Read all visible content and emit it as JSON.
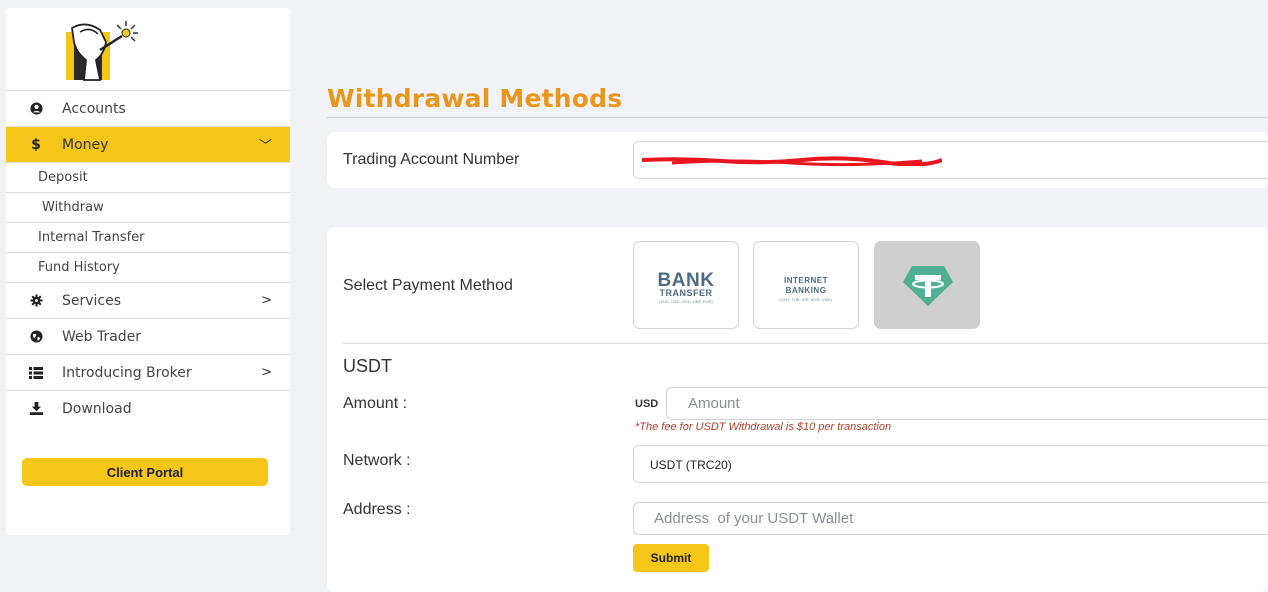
{
  "sidebar": {
    "items": [
      {
        "label": "Accounts",
        "icon": "user-circle-icon"
      },
      {
        "label": "Money",
        "icon": "dollar-icon",
        "chevron": "﹀"
      },
      {
        "label": "Deposit"
      },
      {
        "label": "Withdraw"
      },
      {
        "label": "Internal Transfer"
      },
      {
        "label": "Fund History"
      },
      {
        "label": "Services",
        "icon": "gear-icon",
        "chevron": ">"
      },
      {
        "label": "Web Trader",
        "icon": "globe-icon"
      },
      {
        "label": "Introducing Broker",
        "icon": "list-icon",
        "chevron": ">"
      },
      {
        "label": "Download",
        "icon": "download-icon"
      }
    ],
    "portal_button": "Client Portal"
  },
  "page": {
    "title": "Withdrawal Methods"
  },
  "account": {
    "label": "Trading Account Number"
  },
  "payment": {
    "label": "Select Payment Method",
    "methods": [
      {
        "line1": "BANK",
        "line2": "TRANSFER",
        "line3": "(AUD, USD, SGD, GBP, EUR)"
      },
      {
        "line1": "INTERNET",
        "line2": "BANKING",
        "line3": "(CNY, THB, IDR, MYR, VND)"
      },
      {
        "icon": "tether-icon",
        "selected": true
      }
    ]
  },
  "usdt": {
    "heading": "USDT",
    "amount_label": "Amount :",
    "currency": "USD",
    "amount_placeholder": "Amount",
    "fee_note": "*The fee for USDT Withdrawal is $10 per transaction",
    "network_label": "Network :",
    "network_value": "USDT (TRC20)",
    "address_label": "Address :",
    "address_placeholder": "Address  of your USDT Wallet",
    "submit": "Submit"
  },
  "colors": {
    "accent": "#f5c518",
    "title": "#e9961a",
    "tether": "#50af95",
    "fee_note": "#b5402c",
    "redaction": "#e8141e"
  }
}
